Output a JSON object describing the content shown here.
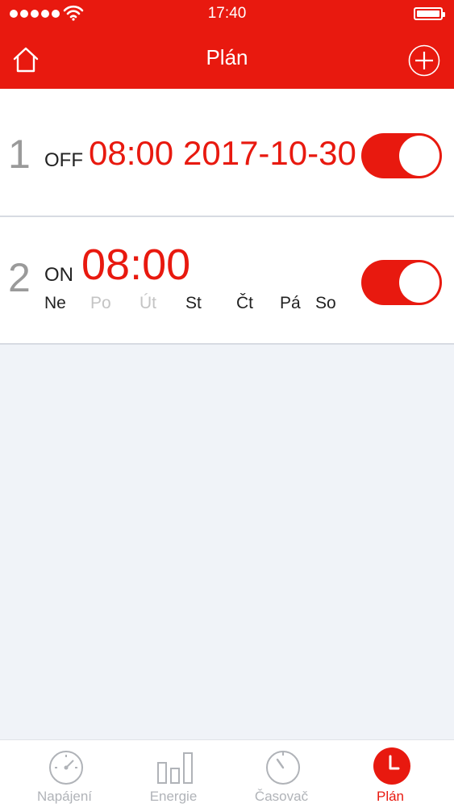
{
  "status_bar": {
    "time": "17:40"
  },
  "header": {
    "title": "Plán",
    "home_icon": "home-icon",
    "add_icon": "plus-circle-icon"
  },
  "colors": {
    "accent": "#e8190f",
    "background": "#f0f3f8",
    "inactive": "#b0b3b8"
  },
  "schedules": [
    {
      "index": "1",
      "state": "OFF",
      "time": "08:00",
      "date": "2017-10-30",
      "enabled": true
    },
    {
      "index": "2",
      "state": "ON",
      "time": "08:00",
      "enabled": true,
      "days": [
        {
          "label": "Ne",
          "active": true
        },
        {
          "label": "Po",
          "active": false
        },
        {
          "label": "Út",
          "active": false
        },
        {
          "label": "St",
          "active": true
        },
        {
          "label": "Čt",
          "active": true
        },
        {
          "label": "Pá",
          "active": true
        },
        {
          "label": "So",
          "active": true
        }
      ]
    }
  ],
  "tabs": [
    {
      "label": "Napájení",
      "icon": "gauge-icon",
      "active": false
    },
    {
      "label": "Energie",
      "icon": "bar-chart-icon",
      "active": false
    },
    {
      "label": "Časovač",
      "icon": "timer-icon",
      "active": false
    },
    {
      "label": "Plán",
      "icon": "clock-icon",
      "active": true
    }
  ]
}
